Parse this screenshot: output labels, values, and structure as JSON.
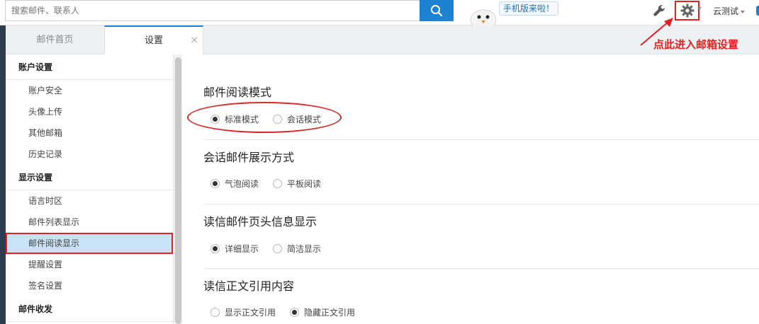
{
  "search": {
    "placeholder": "搜索邮件、联系人"
  },
  "header": {
    "promo_label": "手机版来啦！",
    "user_name": "云测试",
    "icons": {
      "search": "search-icon",
      "tools": "wrench-icon",
      "settings": "gear-icon"
    }
  },
  "tabs": [
    {
      "label": "邮件首页"
    },
    {
      "label": "设置",
      "close": "×"
    }
  ],
  "sidebar": {
    "sections": [
      {
        "title": "账户设置",
        "items": [
          "账户安全",
          "头像上传",
          "其他邮箱",
          "历史记录"
        ]
      },
      {
        "title": "显示设置",
        "items": [
          "语言时区",
          "邮件列表显示",
          "邮件阅读显示",
          "提醒设置",
          "签名设置"
        ]
      },
      {
        "title": "邮件收发",
        "items": []
      }
    ],
    "selected_item": "邮件阅读显示"
  },
  "settings": [
    {
      "title": "邮件阅读模式",
      "options": [
        "标准模式",
        "会话模式"
      ],
      "selected": 0
    },
    {
      "title": "会话邮件展示方式",
      "options": [
        "气泡阅读",
        "平板阅读"
      ],
      "selected": 0
    },
    {
      "title": "读信邮件页头信息显示",
      "options": [
        "详细显示",
        "简洁显示"
      ],
      "selected": 0
    },
    {
      "title": "读信正文引用内容",
      "options": [
        "显示正文引用",
        "隐藏正文引用"
      ],
      "selected": 1
    }
  ],
  "annotation": {
    "text": "点此进入邮箱设置"
  },
  "colors": {
    "accent": "#1e82d2",
    "highlight": "#e62020",
    "selected_bg": "#c9e2f5"
  }
}
